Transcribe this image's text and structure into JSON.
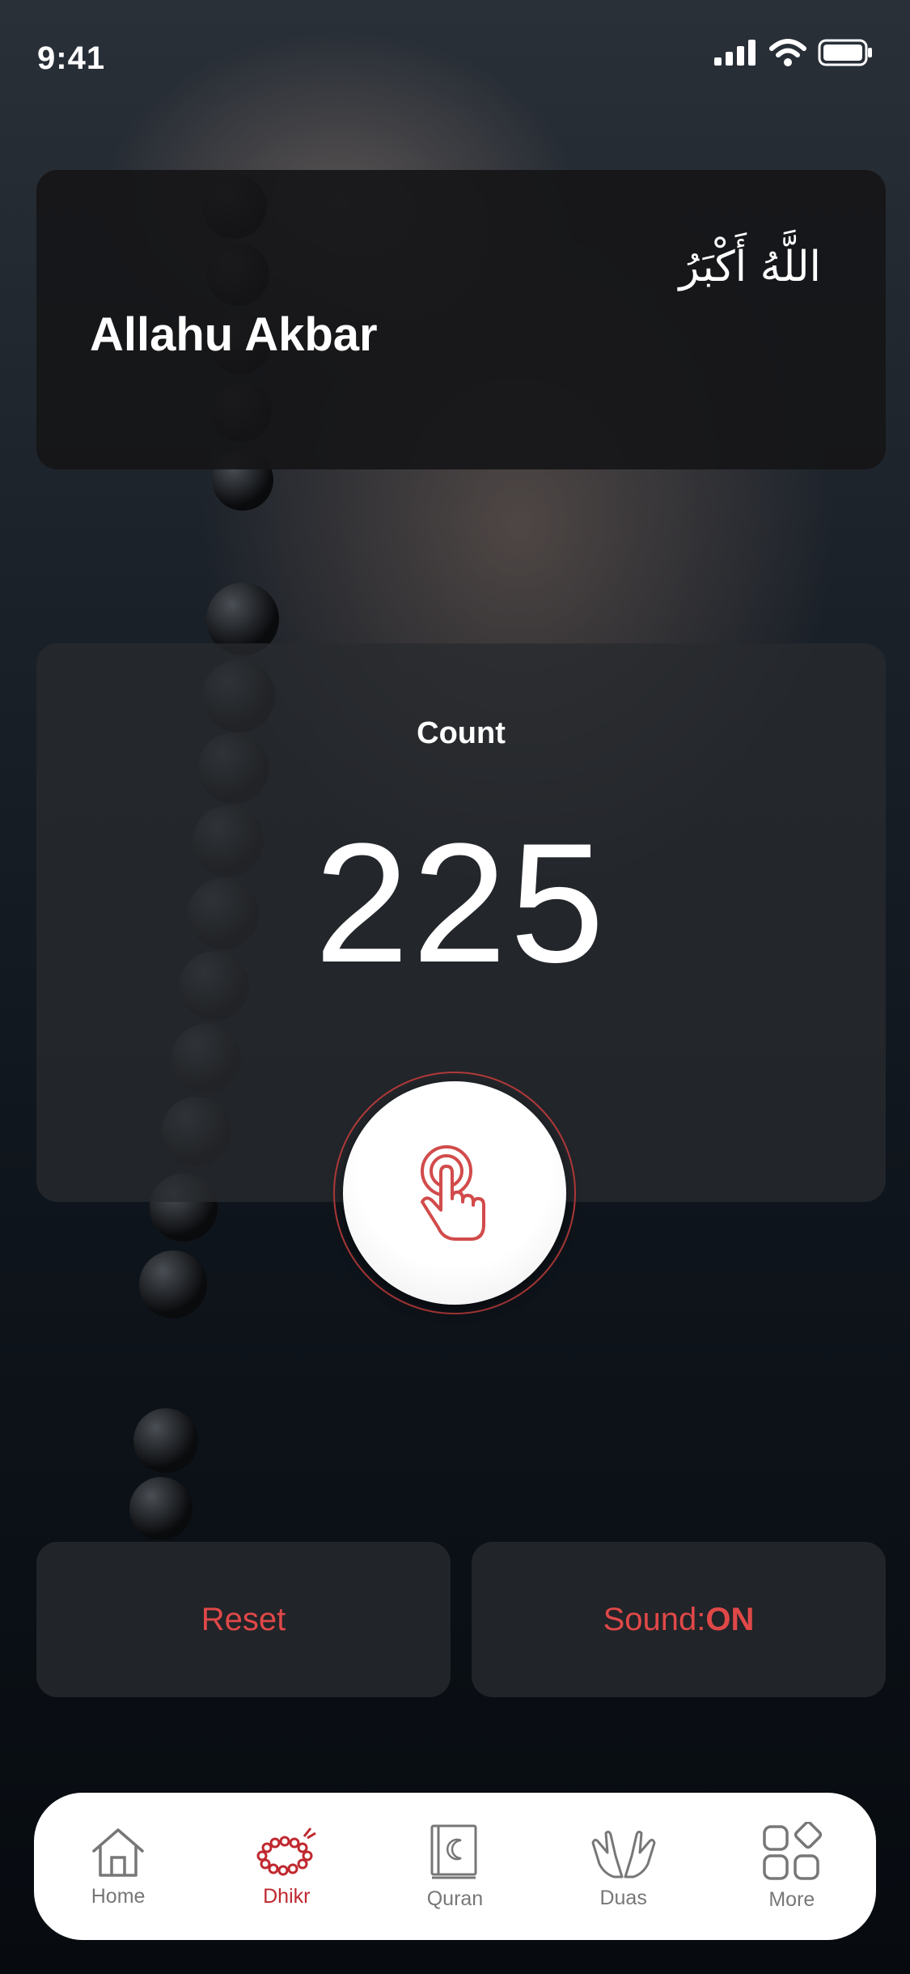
{
  "status_bar": {
    "time": "9:41"
  },
  "dhikr": {
    "arabic": "اللَّهُ أَكْبَرُ",
    "transliteration": "Allahu Akbar"
  },
  "counter": {
    "label": "Count",
    "value": "225"
  },
  "actions": {
    "reset_label": "Reset",
    "sound_prefix": "Sound:",
    "sound_state": "ON"
  },
  "tabs": [
    {
      "label": "Home",
      "icon": "home-icon"
    },
    {
      "label": "Dhikr",
      "icon": "prayer-beads-icon",
      "active": true
    },
    {
      "label": "Quran",
      "icon": "quran-book-icon"
    },
    {
      "label": "Duas",
      "icon": "praying-hands-icon"
    },
    {
      "label": "More",
      "icon": "grid-icon"
    }
  ],
  "colors": {
    "accent": "#c0282f",
    "action_text": "#e04848",
    "card_bg": "#1c1e22",
    "tab_bar_bg": "#ffffff"
  }
}
